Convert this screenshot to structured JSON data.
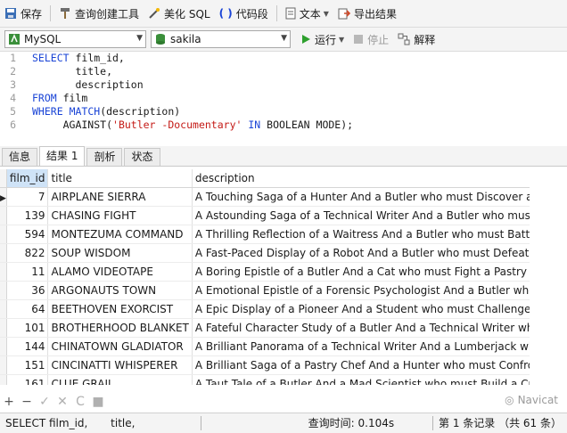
{
  "toolbar": {
    "save": "保存",
    "query_builder": "查询创建工具",
    "beautify_sql": "美化 SQL",
    "code_snippet": "代码段",
    "text": "文本",
    "export_results": "导出结果"
  },
  "toolbar2": {
    "connection": "MySQL",
    "database": "sakila",
    "run": "运行",
    "stop": "停止",
    "explain": "解释"
  },
  "editor": {
    "lines": [
      {
        "n": "1",
        "parts": [
          {
            "k": "kw",
            "t": "SELECT"
          },
          {
            "k": "",
            "t": " film_id,"
          }
        ]
      },
      {
        "n": "2",
        "parts": [
          {
            "k": "",
            "t": "       title,"
          }
        ]
      },
      {
        "n": "3",
        "parts": [
          {
            "k": "",
            "t": "       description"
          }
        ]
      },
      {
        "n": "4",
        "parts": [
          {
            "k": "kw",
            "t": "FROM"
          },
          {
            "k": "",
            "t": " film"
          }
        ]
      },
      {
        "n": "5",
        "parts": [
          {
            "k": "kw",
            "t": "WHERE"
          },
          {
            "k": "",
            "t": " "
          },
          {
            "k": "kw",
            "t": "MATCH"
          },
          {
            "k": "",
            "t": "(description)"
          }
        ]
      },
      {
        "n": "6",
        "parts": [
          {
            "k": "",
            "t": "     AGAINST("
          },
          {
            "k": "str",
            "t": "'Butler -Documentary'"
          },
          {
            "k": "",
            "t": " "
          },
          {
            "k": "kw",
            "t": "IN"
          },
          {
            "k": "",
            "t": " BOOLEAN MODE);"
          }
        ]
      }
    ]
  },
  "tabs": [
    "信息",
    "结果 1",
    "剖析",
    "状态"
  ],
  "active_tab": "结果 1",
  "results": {
    "columns": [
      "film_id",
      "title",
      "description"
    ],
    "rows": [
      [
        "7",
        "AIRPLANE SIERRA",
        "A Touching Saga of a Hunter And a Butler who must Discover a Butl"
      ],
      [
        "139",
        "CHASING FIGHT",
        "A Astounding Saga of a Technical Writer And a Butler who must Bat"
      ],
      [
        "594",
        "MONTEZUMA COMMAND",
        "A Thrilling Reflection of a Waitress And a Butler who must Battle a Bu"
      ],
      [
        "822",
        "SOUP WISDOM",
        "A Fast-Paced Display of a Robot And a Butler who must Defeat a Butl"
      ],
      [
        "11",
        "ALAMO VIDEOTAPE",
        "A Boring Epistle of a Butler And a Cat who must Fight a Pastry Chef i"
      ],
      [
        "36",
        "ARGONAUTS TOWN",
        "A Emotional Epistle of a Forensic Psychologist And a Butler who mus"
      ],
      [
        "64",
        "BEETHOVEN EXORCIST",
        "A Epic Display of a Pioneer And a Student who must Challenge a Butl"
      ],
      [
        "101",
        "BROTHERHOOD BLANKET",
        "A Fateful Character Study of a Butler And a Technical Writer who mu"
      ],
      [
        "144",
        "CHINATOWN GLADIATOR",
        "A Brilliant Panorama of a Technical Writer And a Lumberjack who m"
      ],
      [
        "151",
        "CINCINATTI WHISPERER",
        "A Brilliant Saga of a Pastry Chef And a Hunter who must Confront a"
      ],
      [
        "161",
        "CLUE GRAIL",
        "A Taut Tale of a Butler And a Mad Scientist who must Build a Crocod"
      ]
    ]
  },
  "watermark": "Navicat",
  "status": {
    "sql": "SELECT film_id,",
    "sql2": "title,",
    "query_time": "查询时间: 0.104s",
    "records": "第 1 条记录 （共 61 条）"
  },
  "colors": {
    "accent": "#1a44d6",
    "string": "#c41a16",
    "header_selected": "#cfe3f7"
  }
}
